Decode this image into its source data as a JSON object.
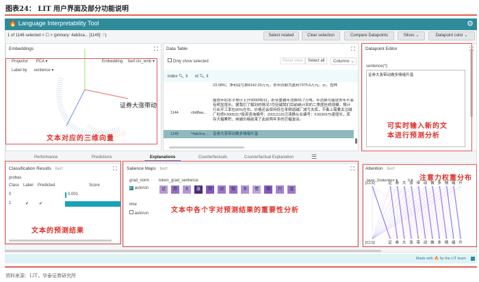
{
  "figure": {
    "title": "图表24：  LIT 用户界面及部分功能说明",
    "source": "资料来源：LIT，华泰证券研究所"
  },
  "app": {
    "title": "Language Interpretability Tool",
    "selection": "1 of 1146 selected <  ☐  >  (primary: 4ab3ca... [1145]  ♡)",
    "buttons": [
      "Select related",
      "Clear selection",
      "Compare Datapoints",
      "Slices ⌄",
      "Datapoint color ⌄"
    ]
  },
  "embeddings": {
    "title": "Embeddings",
    "projector_label": "Projector",
    "projector": "PCA ▾",
    "embedding_label": "Embedding",
    "embedding": "bert:cls_emb ▾",
    "labelby_label": "Label by",
    "labelby": "sentence ▾",
    "point_label": "证券大涨带动",
    "annotation": "文本对应的三维向量"
  },
  "datatable": {
    "title": "Data Table",
    "only_selected": "Only show selected",
    "reset": "Reset view",
    "select_all": "Select all",
    "columns": "Columns ⌄",
    "headers": [
      "index",
      "id"
    ],
    "rows": [
      {
        "index": "",
        "id": "",
        "text": "23.08%；净利润亏损8142.20万元，去年同期为盈利7075.6万元。示，吉林"
      },
      {
        "index": "1144",
        "id": "cbd8aa...",
        "text": "能较年初水平预计上升9000吨/日，折合重碱年消费65.7万吨。年消费可能较去年不会有明显增长。据我们了解到的情况7月轻碱我们目前统计到的二季度检修规模，预计行业开工率在80%左右。价格还会保持低位来倒逼碱厂减亏去库，节奏上需要关注碱厂检修F3005317投资咨询编号：Z0012125汪清静从业编号：F3030975速增长，库存大幅累积，纯碱价格结束了此前两年多的巨幅波动。"
      },
      {
        "index": "1145",
        "id": "*4ab3ca...",
        "text": "证券大涨带动做多情绪升温"
      }
    ]
  },
  "editor": {
    "title": "Datapoint Editor",
    "field_label": "sentence(*):",
    "value": "证券大涨带动做多情绪升温",
    "annotation_line1": "可实时输入新的文",
    "annotation_line2": "本进行预测分析"
  },
  "tabs": [
    "Performance",
    "Predictions",
    "Explanations",
    "Counterfactuals",
    "Counterfactual Explanation"
  ],
  "classification": {
    "title": "Classification Results",
    "model": "bert",
    "probas": "probas",
    "headers": [
      "Class",
      "Label",
      "Predicted",
      "Score"
    ],
    "rows": [
      {
        "class": "0",
        "label": "",
        "predicted": "",
        "score": "0.001",
        "value": 0.001
      },
      {
        "class": "1",
        "label": "✔",
        "predicted": "✔",
        "score": "0",
        "value": 0.999
      }
    ],
    "annotation": "文本的预测结果"
  },
  "salience": {
    "title": "Salience Maps",
    "model": "bert",
    "method1": "grad_norm",
    "field": "token_grad_sentence",
    "autorun": "autorun",
    "method2": "lime",
    "tokens": [
      "证",
      "券",
      "大",
      "涨",
      "带",
      "动",
      "做",
      "多",
      "情",
      "绪",
      "升",
      "温"
    ],
    "weights": [
      0.25,
      0.45,
      0.25,
      0.95,
      0.55,
      0.4,
      0.45,
      0.3,
      0.2,
      0.55,
      0.35,
      0.4
    ],
    "annotation": "文本中各个字对预测结果的重要性分析"
  },
  "attention": {
    "title": "Attention",
    "model": "bert",
    "layer": "layer_0/attention ▾",
    "head": "0 ▾",
    "tokens": [
      "[CLS]",
      "证",
      "券",
      "大",
      "涨",
      "带",
      "动",
      "做",
      "多",
      "情",
      "绪",
      "升"
    ],
    "annotation": "注意力权重分布"
  },
  "footer": {
    "made_with": "Made with 🔥 by the LIT team"
  },
  "colors": {
    "header": "#2e8b9a",
    "accent": "#17a2b8",
    "annotation": "#e0302a",
    "token": "#7e57c2"
  }
}
